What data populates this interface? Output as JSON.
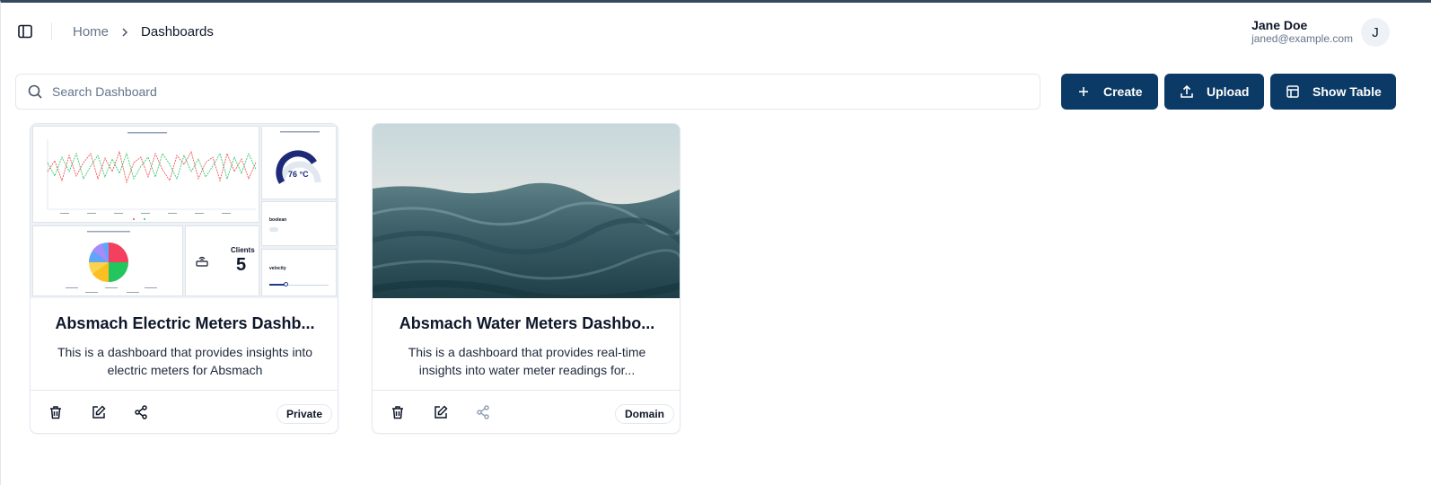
{
  "header": {
    "breadcrumb": {
      "home": "Home",
      "current": "Dashboards"
    },
    "user": {
      "name": "Jane Doe",
      "email": "janed@example.com",
      "avatar_initial": "J"
    }
  },
  "toolbar": {
    "search_placeholder": "Search Dashboard",
    "search_value": "",
    "create_label": "Create",
    "upload_label": "Upload",
    "show_table_label": "Show Table"
  },
  "colors": {
    "primary": "#0b3a66",
    "border": "#e2e8f0",
    "muted_text": "#64748b"
  },
  "dashboards": [
    {
      "title": "Absmach Electric Meters Dashb...",
      "description": "This is a dashboard that provides insights into electric meters for Absmach",
      "visibility": "Private",
      "thumbnail": {
        "gauge_value": "76 °C",
        "clients_label": "Clients",
        "clients_value": "5",
        "switch_label": "boolean",
        "slider_label": "velocity"
      }
    },
    {
      "title": "Absmach Water Meters Dashbo...",
      "description": "This is a dashboard that provides real-time insights into water meter readings for...",
      "visibility": "Domain"
    }
  ],
  "icons": {
    "sidebar_toggle": "sidebar-toggle-icon",
    "chevron": "chevron-right-icon",
    "search": "search-icon",
    "create": "plus-icon",
    "upload": "upload-icon",
    "table": "table-icon",
    "delete": "trash-icon",
    "edit": "edit-icon",
    "share": "share-icon"
  }
}
